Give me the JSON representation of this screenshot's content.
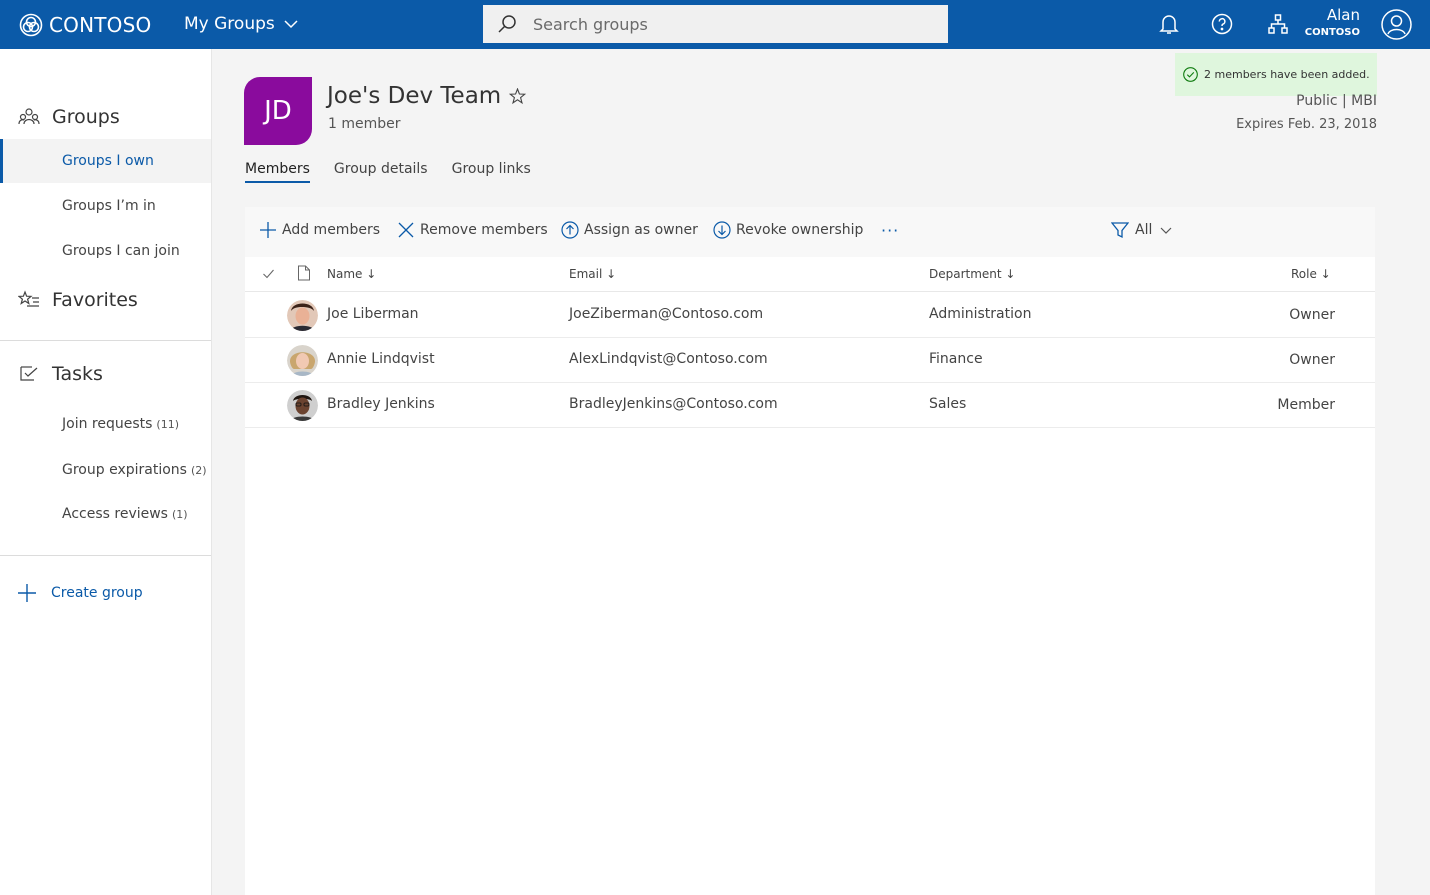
{
  "topbar": {
    "brand": "CONTOSO",
    "app_switch": "My Groups",
    "search_placeholder": "Search groups",
    "user_name": "Alan",
    "user_org": "CONTOSO"
  },
  "sidebar": {
    "groups_heading": "Groups",
    "items": [
      {
        "label": "Groups I own"
      },
      {
        "label": "Groups I’m in"
      },
      {
        "label": "Groups I can join"
      }
    ],
    "favorites_heading": "Favorites",
    "tasks_heading": "Tasks",
    "tasks": [
      {
        "label": "Join requests",
        "count": "(11)"
      },
      {
        "label": "Group expirations",
        "count": "(2)"
      },
      {
        "label": "Access reviews",
        "count": "(1)"
      }
    ],
    "create_label": "Create group"
  },
  "group": {
    "initials": "JD",
    "title": "Joe's Dev Team",
    "subtitle": "1 member",
    "visibility": "Public | MBI",
    "expires": "Expires Feb. 23, 2018",
    "tile_color": "#8a0b9d"
  },
  "toast": {
    "message": "2 members have been added."
  },
  "tabs": [
    {
      "label": "Members"
    },
    {
      "label": "Group details"
    },
    {
      "label": "Group links"
    }
  ],
  "toolbar": {
    "add": "Add members",
    "remove": "Remove members",
    "assign": "Assign as owner",
    "revoke": "Revoke ownership",
    "more": "···",
    "filter": "All"
  },
  "table": {
    "headers": {
      "name": "Name ↓",
      "email": "Email ↓",
      "department": "Department ↓",
      "role": "Role ↓"
    },
    "rows": [
      {
        "name": "Joe Liberman",
        "email": "JoeZiberman@Contoso.com",
        "department": "Administration",
        "role": "Owner"
      },
      {
        "name": "Annie Lindqvist",
        "email": "AlexLindqvist@Contoso.com",
        "department": "Finance",
        "role": "Owner"
      },
      {
        "name": "Bradley Jenkins",
        "email": "BradleyJenkins@Contoso.com",
        "department": "Sales",
        "role": "Member"
      }
    ]
  },
  "colors": {
    "accent": "#0b5aa8",
    "toast_bg": "#dff6dd",
    "success": "#107c10"
  }
}
